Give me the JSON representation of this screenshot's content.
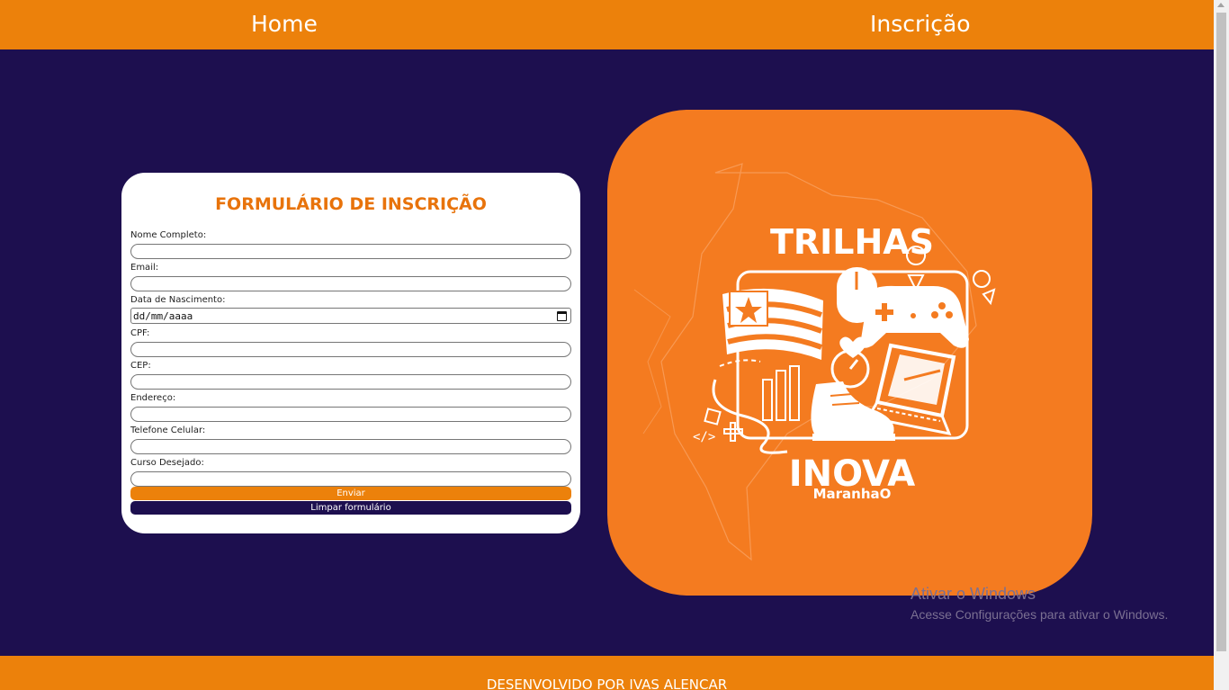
{
  "nav": {
    "home": "Home",
    "inscricao": "Inscrição"
  },
  "form": {
    "title": "FORMULÁRIO DE INSCRIÇÃO",
    "fields": [
      {
        "label": "Nome Completo:",
        "value": ""
      },
      {
        "label": "Email:",
        "value": ""
      },
      {
        "label": "Data de Nascimento:",
        "value": "dd/mm/aaaa"
      },
      {
        "label": "CPF:",
        "value": ""
      },
      {
        "label": "CEP:",
        "value": ""
      },
      {
        "label": "Endereço:",
        "value": ""
      },
      {
        "label": "Telefone Celular:",
        "value": ""
      },
      {
        "label": "Curso Desejado:",
        "value": ""
      }
    ],
    "submit_label": "Enviar",
    "clear_label": "Limpar formulário"
  },
  "logo": {
    "title": "TRILHAS",
    "brand": "INOVA",
    "brand_sub": "MaranhaO"
  },
  "watermark": {
    "title": "Ativar o Windows",
    "subtitle": "Acesse Configurações para ativar o Windows."
  },
  "footer": {
    "text": "DESENVOLVIDO POR IVAS ALENCAR"
  },
  "colors": {
    "orange": "#ec810b",
    "logo_orange": "#f47b20",
    "navy": "#1d0f4f",
    "white": "#ffffff"
  },
  "icons": [
    "calendar-icon",
    "flag-icon",
    "gamepad-icon",
    "mouse-icon",
    "laptop-icon",
    "sneaker-icon",
    "stopwatch-icon",
    "heart-icon",
    "location-pin-icon",
    "code-icon",
    "plus-icon"
  ]
}
